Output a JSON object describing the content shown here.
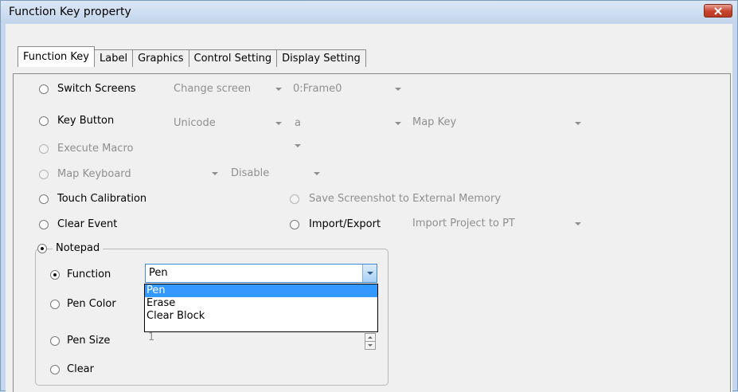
{
  "window": {
    "title": "Function Key property",
    "close_icon": "close-x-icon"
  },
  "tabs": [
    {
      "label": "Function Key",
      "active": true
    },
    {
      "label": "Label"
    },
    {
      "label": "Graphics"
    },
    {
      "label": "Control Setting"
    },
    {
      "label": "Display Setting"
    }
  ],
  "options": {
    "switch_screens": {
      "label": "Switch Screens",
      "combo1": "Change screen",
      "combo2": "0:Frame0"
    },
    "key_button": {
      "label": "Key Button",
      "combo1": "Unicode",
      "input": "a",
      "combo2": "",
      "map_key_label": "Map Key",
      "map_key_value": ""
    },
    "execute_macro": {
      "label": "Execute Macro",
      "combo": ""
    },
    "map_keyboard": {
      "label": "Map Keyboard",
      "combo1": "",
      "combo2": "Disable"
    },
    "touch_calibration": {
      "label": "Touch Calibration"
    },
    "save_screenshot": {
      "label": "Save Screenshot to External Memory"
    },
    "clear_event": {
      "label": "Clear Event"
    },
    "import_export": {
      "label": "Import/Export",
      "combo": "Import Project to PT"
    },
    "notepad": {
      "label": "Notepad",
      "selected": true,
      "function": {
        "label": "Function",
        "selected": true,
        "value": "Pen"
      },
      "dropdown_options": [
        "Pen",
        "Erase",
        "Clear Block"
      ],
      "pen_color": {
        "label": "Pen Color"
      },
      "pen_size": {
        "label": "Pen Size",
        "value": "1"
      },
      "clear": {
        "label": "Clear"
      }
    }
  },
  "colors": {
    "titlebar": "#c3d5ec",
    "close": "#c7432c",
    "selection": "#3399ff"
  }
}
